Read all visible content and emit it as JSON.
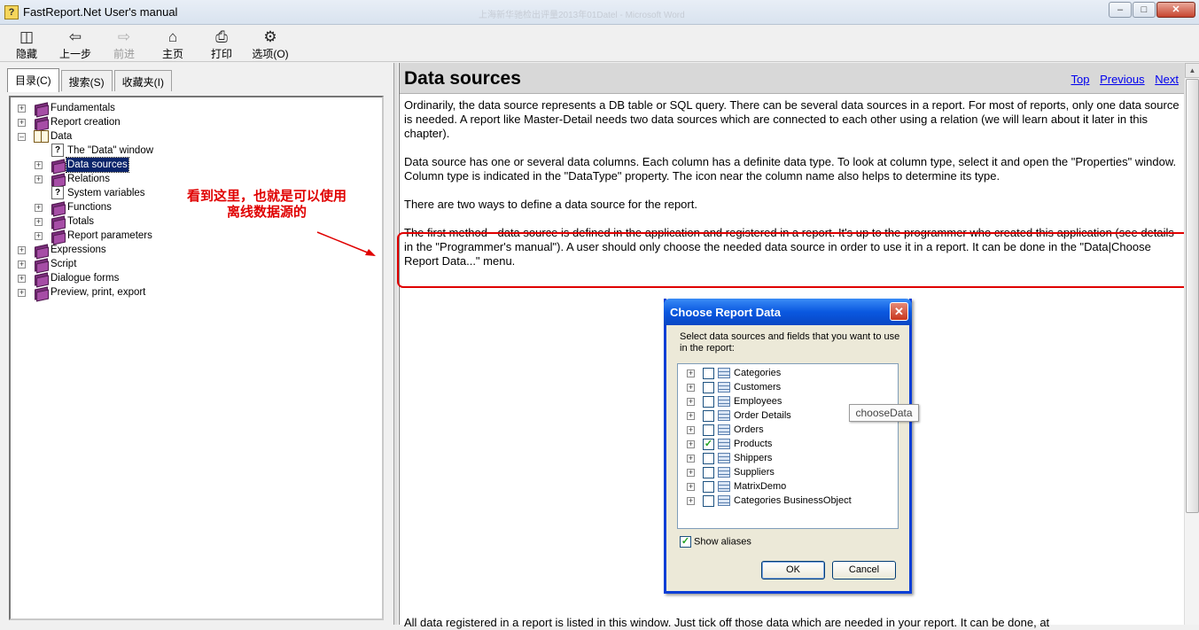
{
  "window": {
    "title": "FastReport.Net User's manual",
    "background_title": "上海新华驰检出评量2013年01Datel - Microsoft Word"
  },
  "toolbar": {
    "hide": "隐藏",
    "back": "上一步",
    "forward": "前进",
    "home": "主页",
    "print": "打印",
    "options": "选项(O)"
  },
  "tabs": {
    "contents": "目录(C)",
    "search": "搜索(S)",
    "favorites": "收藏夹(I)"
  },
  "tree": {
    "items": [
      {
        "label": "Fundamentals"
      },
      {
        "label": "Report creation"
      },
      {
        "label": "Data"
      },
      {
        "label": "The \"Data\" window"
      },
      {
        "label": "Data sources"
      },
      {
        "label": "Relations"
      },
      {
        "label": "System variables"
      },
      {
        "label": "Functions"
      },
      {
        "label": "Totals"
      },
      {
        "label": "Report parameters"
      },
      {
        "label": "Expressions"
      },
      {
        "label": "Script"
      },
      {
        "label": "Dialogue forms"
      },
      {
        "label": "Preview, print, export"
      }
    ]
  },
  "annotation": {
    "line1": "看到这里，也就是可以使用",
    "line2": "离线数据源的",
    "color": "#e00000"
  },
  "page": {
    "title": "Data sources",
    "nav": {
      "top": "Top",
      "previous": "Previous",
      "next": "Next"
    },
    "paragraphs": [
      "Ordinarily, the data source represents a DB table or SQL query. There can be several data sources in a report. For most of reports, only one data source is needed. A report like Master-Detail needs two data sources which are connected to each other using a relation (we will learn about it later in this chapter).",
      "Data source has one or several data columns. Each column has a definite data type. To look at column type, select it and open the \"Properties\" window. Column type is indicated in the \"DataType\" property. The icon near the column name also helps to determine its type.",
      "There are two ways to define a data source for the report.",
      "The first method - data source is defined in the application and registered in a report. It's up to the programmer who created this application (see details in the \"Programmer's manual\"). A user should only choose the needed data source in order to use it in a report. It can be done in the \"Data|Choose Report Data...\" menu."
    ],
    "bottom_text": "All data registered in a report is listed in this window. Just tick off those data which are needed in your report. It can be done, at"
  },
  "dialog": {
    "title": "Choose Report Data",
    "description": "Select data sources and fields that you want to use in the report:",
    "items": [
      {
        "name": "Categories",
        "checked": ""
      },
      {
        "name": "Customers",
        "checked": ""
      },
      {
        "name": "Employees",
        "checked": ""
      },
      {
        "name": "Order Details",
        "checked": ""
      },
      {
        "name": "Orders",
        "checked": ""
      },
      {
        "name": "Products",
        "checked": "✓"
      },
      {
        "name": "Shippers",
        "checked": ""
      },
      {
        "name": "Suppliers",
        "checked": ""
      },
      {
        "name": "MatrixDemo",
        "checked": ""
      },
      {
        "name": "Categories BusinessObject",
        "checked": ""
      }
    ],
    "show_aliases": "Show aliases",
    "show_aliases_check": "✓",
    "ok": "OK",
    "cancel": "Cancel"
  },
  "tooltip": "chooseData"
}
